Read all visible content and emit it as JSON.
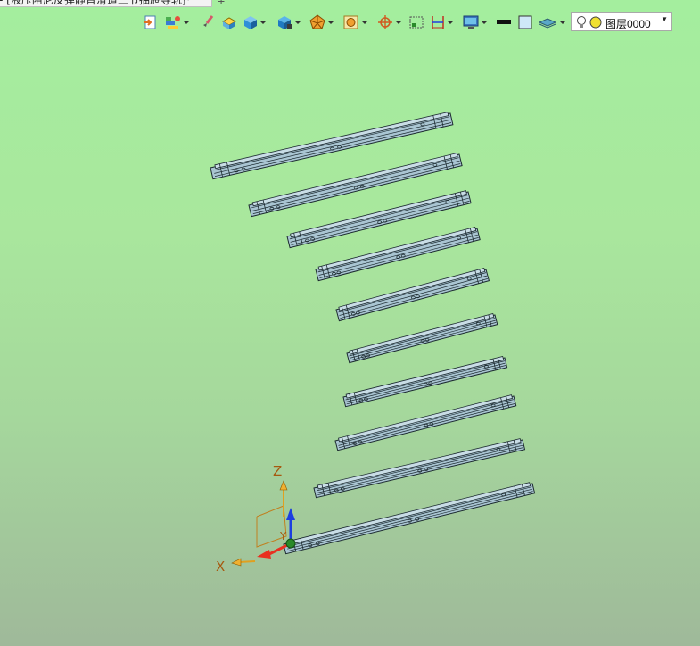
{
  "tab": {
    "title": "- [液压阻尼反弹静音滑道三节抽屉导轨]",
    "close_icon": "×",
    "add_icon": "+"
  },
  "layer_selector": {
    "value": "图层0000",
    "icons": [
      "bulb-icon",
      "sun-icon"
    ]
  },
  "toolbar_icons": [
    "view-import-icon",
    "layers-color-icon",
    "paint-brush-icon",
    "render-style-icon",
    "shaded-cube-icon",
    "view-orientation-icon",
    "explode-view-icon",
    "display-filter-icon",
    "snap-target-icon",
    "frame-icon",
    "dimension-icon",
    "monitor-icon",
    "line-color-icon",
    "face-color-icon",
    "stack-icon"
  ],
  "colors": {
    "part_fill": "#a9c5d2",
    "part_edge": "#1c2a30",
    "bg_top": "#a4ee9e",
    "bg_bottom": "#9fb99a",
    "axis_x": "#e83020",
    "axis_y": "#2a8a2a",
    "axis_z": "#1d3fe0",
    "axis_label": "#a65a10"
  },
  "triad": {
    "x_label": "X",
    "y_label": "Y",
    "z_label": "Z"
  },
  "parts": {
    "count": 10,
    "name": "drawer-slide-rail"
  }
}
